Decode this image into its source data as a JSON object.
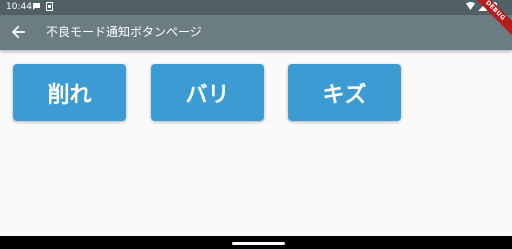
{
  "status_bar": {
    "time": "10:44",
    "left_icons": [
      "message-icon",
      "sim-icon"
    ],
    "right_icons": [
      "wifi-icon",
      "signal-icon",
      "battery-icon"
    ]
  },
  "app_bar": {
    "back_icon": "arrow-back-icon",
    "title": "不良モード通知ボタンページ",
    "background_color": "#6b7c83"
  },
  "debug_banner": {
    "label": "DEBUG"
  },
  "buttons": [
    {
      "label": "削れ"
    },
    {
      "label": "バリ"
    },
    {
      "label": "キズ"
    }
  ],
  "colors": {
    "button": "#3c9bd2",
    "status_bar": "#515f66",
    "background": "#fafafa"
  }
}
